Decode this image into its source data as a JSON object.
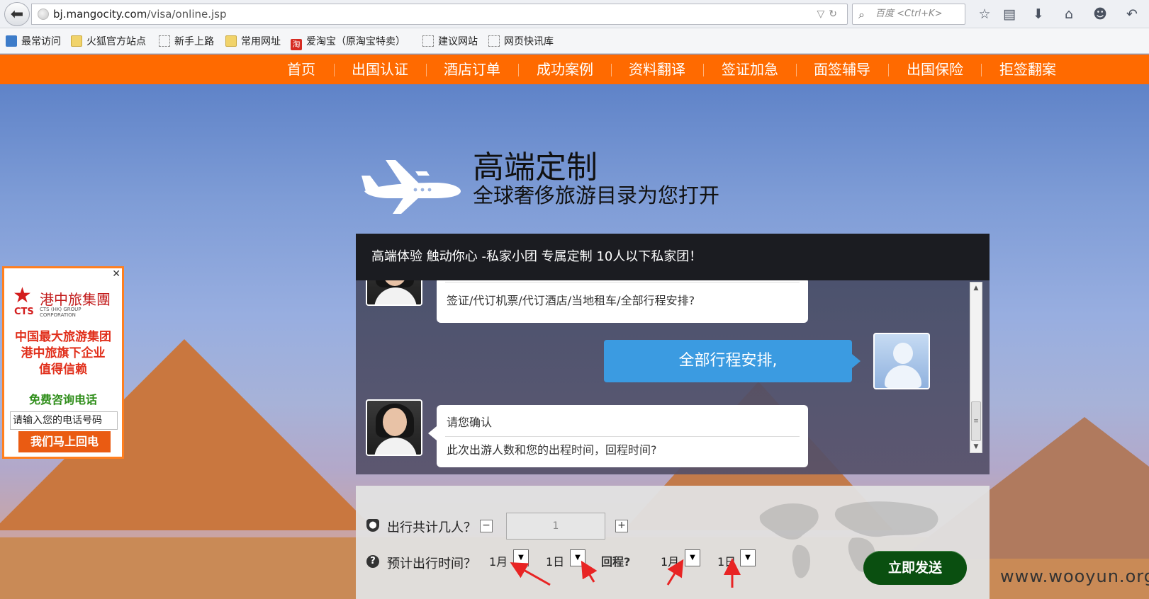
{
  "browser": {
    "url_host": "bj.mangocity.com",
    "url_path": "/visa/online.jsp",
    "search_placeholder": "百度 <Ctrl+K>",
    "bookmarks": [
      "最常访问",
      "火狐官方站点",
      "新手上路",
      "常用网址",
      "爱淘宝（原淘宝特卖）",
      "建议网站",
      "网页快讯库"
    ]
  },
  "nav": {
    "items": [
      "首页",
      "出国认证",
      "酒店订单",
      "成功案例",
      "资料翻译",
      "签证加急",
      "面签辅导",
      "出国保险",
      "拒签翻案"
    ]
  },
  "hero": {
    "title": "高端定制",
    "subtitle": "全球奢侈旅游目录为您打开"
  },
  "chat": {
    "header": "高端体验 触动你心 -私家小团 专属定制 10人以下私家团！",
    "bot_msg_1": "签证/代订机票/代订酒店/当地租车/全部行程安排?",
    "user_msg": "全部行程安排,",
    "bot_msg_2_line1": "请您确认",
    "bot_msg_2_line2": "此次出游人数和您的出程时间，回程时间?"
  },
  "form": {
    "people_label": "出行共计几人？",
    "people_value": "1",
    "minus": "−",
    "plus": "+",
    "date_label": "预计出行时间？",
    "depart_month": "1月",
    "depart_day": "1日",
    "return_label": "回程?",
    "return_month": "1月",
    "return_day": "1日",
    "send_button": "立即发送"
  },
  "ad": {
    "brand_cn": "港中旅集團",
    "brand_abbr": "CTS",
    "brand_en": "CTS (HK) GROUP CORPORATION",
    "slogan_1": "中国最大旅游集团",
    "slogan_2": "港中旅旗下企业",
    "slogan_3": "值得信赖",
    "phone_label": "免费咨询电话",
    "input_value": "请输入您的电话号码",
    "button": "我们马上回电"
  },
  "watermark": "www.wooyun.org",
  "colors": {
    "nav_bg": "#ff6a00",
    "user_bubble": "#3b9be1",
    "send_button": "#0a4f10",
    "annotation_arrow": "#e82424"
  }
}
